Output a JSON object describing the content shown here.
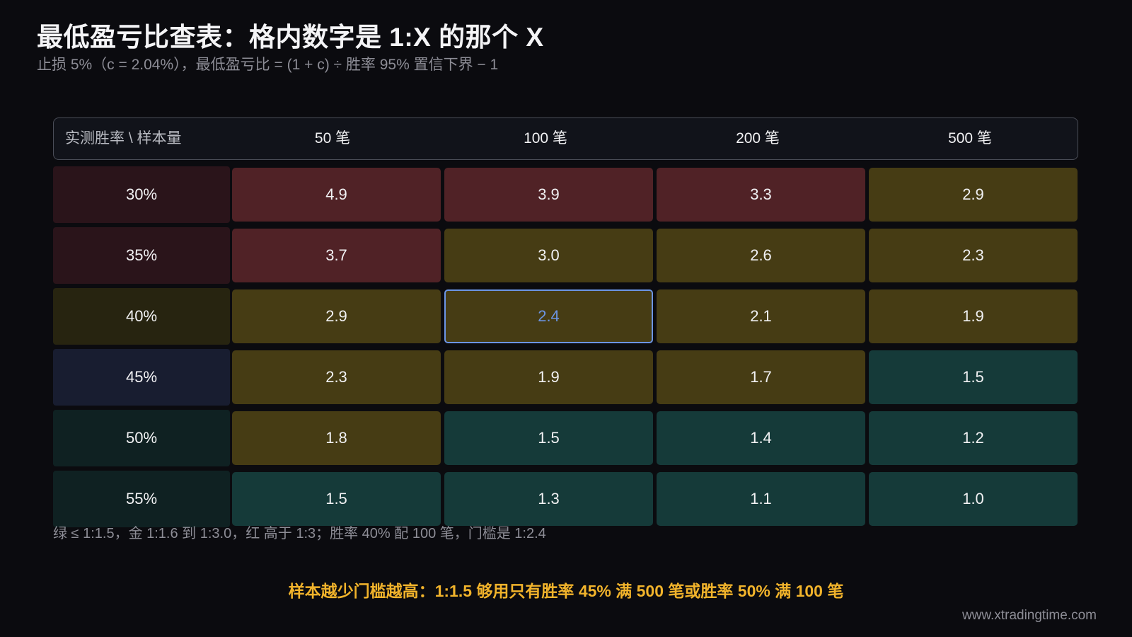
{
  "title": "最低盈亏比查表：格内数字是 1:X 的那个 X",
  "subtitle": "止损 5%（c = 2.04%），最低盈亏比 = (1 + c) ÷ 胜率 95% 置信下界 − 1",
  "table": {
    "corner": "实测胜率 \\ 样本量",
    "columns": [
      "50 笔",
      "100 笔",
      "200 笔",
      "500 笔"
    ],
    "rows": [
      {
        "label": "30%",
        "values": [
          "4.9",
          "3.9",
          "3.3",
          "2.9"
        ],
        "levels": [
          "red",
          "red",
          "red",
          "gold"
        ]
      },
      {
        "label": "35%",
        "values": [
          "3.7",
          "3.0",
          "2.6",
          "2.3"
        ],
        "levels": [
          "red",
          "gold",
          "gold",
          "gold"
        ]
      },
      {
        "label": "40%",
        "values": [
          "2.9",
          "2.4",
          "2.1",
          "1.9"
        ],
        "levels": [
          "gold",
          "gold",
          "gold",
          "gold"
        ]
      },
      {
        "label": "45%",
        "values": [
          "2.3",
          "1.9",
          "1.7",
          "1.5"
        ],
        "levels": [
          "gold",
          "gold",
          "gold",
          "green"
        ]
      },
      {
        "label": "50%",
        "values": [
          "1.8",
          "1.5",
          "1.4",
          "1.2"
        ],
        "levels": [
          "gold",
          "green",
          "green",
          "green"
        ]
      },
      {
        "label": "55%",
        "values": [
          "1.5",
          "1.3",
          "1.1",
          "1.0"
        ],
        "levels": [
          "green",
          "green",
          "green",
          "green"
        ]
      }
    ],
    "highlight": {
      "row": 2,
      "col": 1
    },
    "row_label_colors": [
      "#2a141a",
      "#2a141a",
      "#272410",
      "#181d30",
      "#0f2122",
      "#0f2122"
    ]
  },
  "colors": {
    "red": "#502226",
    "gold": "#463c14",
    "green": "#153a39",
    "highlight_border": "#6c95e4",
    "accent": "#f1b32b"
  },
  "legend": "绿 ≤ 1:1.5，金 1:1.6 到 1:3.0，红 高于 1:3；胜率 40% 配 100 笔，门槛是 1:2.4",
  "conclusion": "样本越少门槛越高：1:1.5 够用只有胜率 45% 满 500 笔或胜率 50% 满 100 笔",
  "watermark": "www.xtradingtime.com"
}
